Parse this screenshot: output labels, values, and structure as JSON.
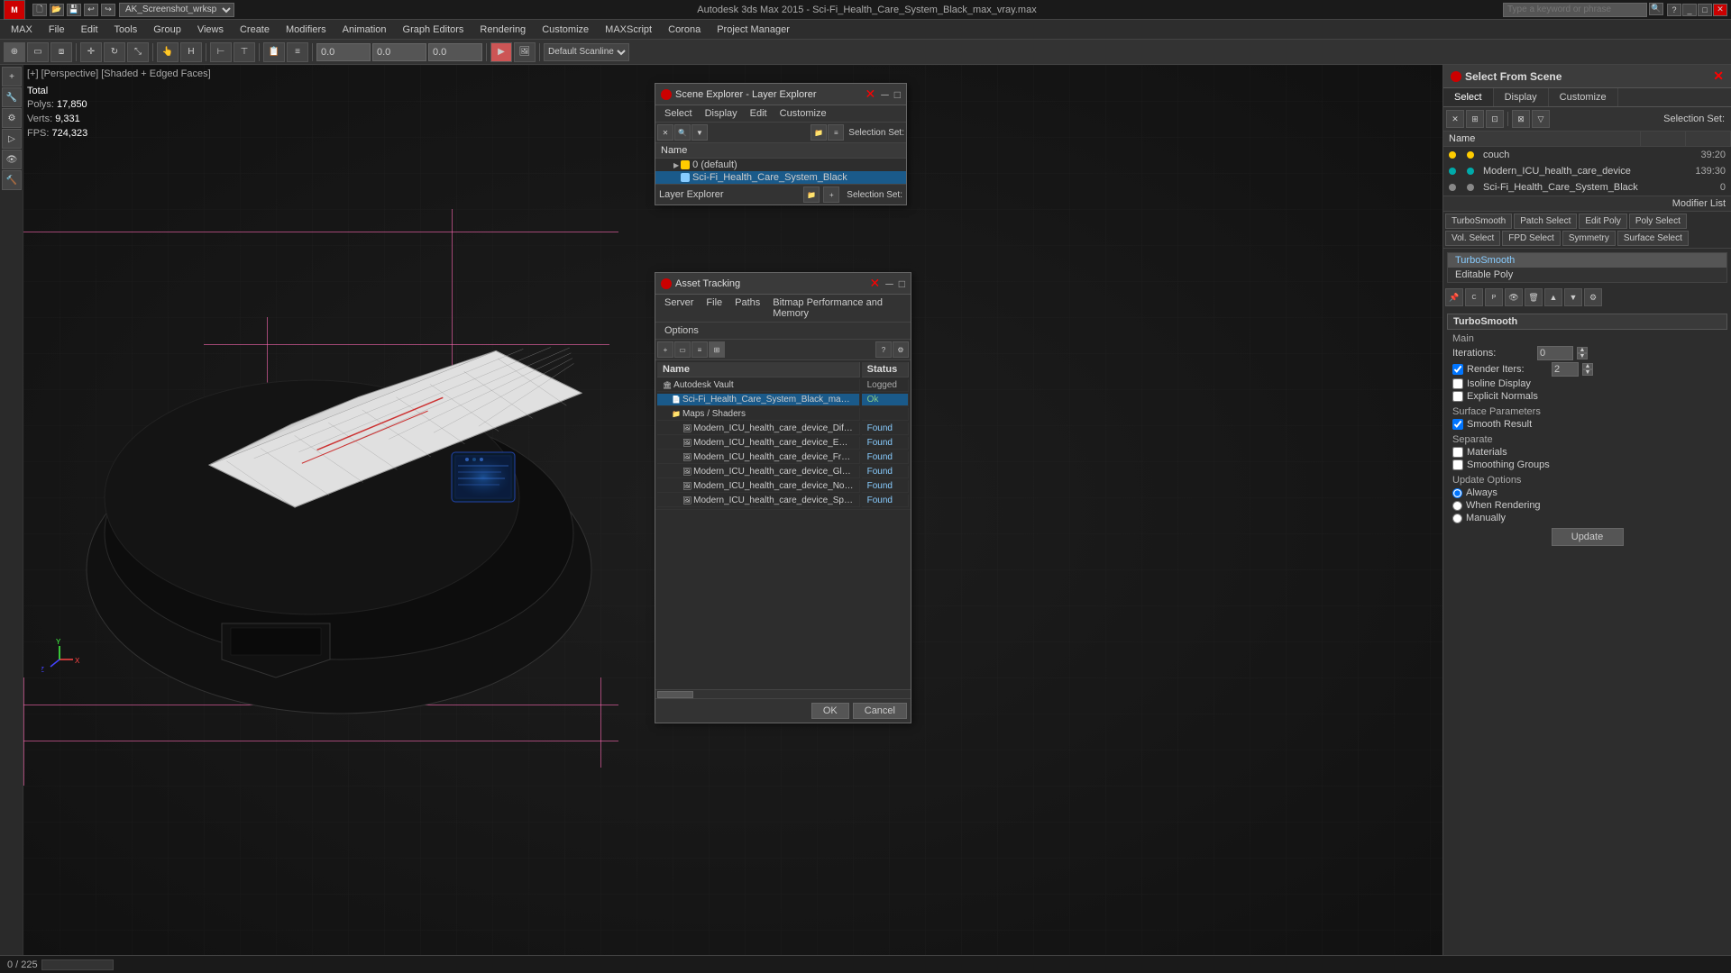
{
  "app": {
    "title": "Autodesk 3ds Max 2015 - Sci-Fi_Health_Care_System_Black_max_vray.max",
    "screenshot_name": "AK_Screenshot_wrksp"
  },
  "menubar": {
    "items": [
      "MAX",
      "File",
      "Edit",
      "Tools",
      "Group",
      "Views",
      "Create",
      "Modifiers",
      "Animation",
      "Graph Editors",
      "Rendering",
      "Customize",
      "MAXScript",
      "Corona",
      "Project Manager"
    ]
  },
  "viewport": {
    "label": "[+] [Perspective] [Shaded + Edged Faces]",
    "stats": {
      "total": "Total",
      "polys_label": "Polys:",
      "polys_value": "17,850",
      "verts_label": "Verts:",
      "verts_value": "9,331",
      "fps_label": "FPS:",
      "fps_value": "724,323"
    }
  },
  "scene_explorer": {
    "title": "Scene Explorer - Layer Explorer",
    "menus": [
      "Select",
      "Display",
      "Edit",
      "Customize"
    ],
    "columns": [
      "Name"
    ],
    "rows": [
      {
        "name": "0 (default)",
        "indent": 0,
        "type": "layer",
        "expanded": true
      },
      {
        "name": "Sci-Fi_Health_Care_System_Black",
        "indent": 1,
        "type": "layer",
        "selected": true
      }
    ],
    "footer": "Layer Explorer",
    "selection_set": "Selection Set:"
  },
  "select_from_scene": {
    "title": "Select From Scene",
    "tabs": [
      "Select",
      "Display",
      "Customize"
    ],
    "active_tab": "Select",
    "columns": [
      "Name",
      "",
      ""
    ],
    "objects": [
      {
        "name": "couch",
        "count": "39:20",
        "dot_color": "yellow"
      },
      {
        "name": "Modern_ICU_health_care_device",
        "count": "139:30",
        "dot_color": "teal"
      },
      {
        "name": "Sci-Fi_Health_Care_System_Black",
        "count": "0",
        "dot_color": "gray"
      }
    ],
    "selection_set_label": "Selection Set:"
  },
  "asset_tracking": {
    "title": "Asset Tracking",
    "menus": [
      "Server",
      "File",
      "Paths",
      "Bitmap Performance and Memory",
      "Options"
    ],
    "columns": [
      "Name",
      "Status"
    ],
    "assets": [
      {
        "name": "Autodesk Vault",
        "status": "",
        "indent": 0,
        "type": "folder"
      },
      {
        "name": "Sci-Fi_Health_Care_System_Black_max_vray.max",
        "status": "Ok",
        "indent": 1,
        "type": "file"
      },
      {
        "name": "Maps / Shaders",
        "status": "",
        "indent": 1,
        "type": "folder"
      },
      {
        "name": "Modern_ICU_health_care_device_Diffuse...",
        "status": "Found",
        "indent": 2,
        "type": "map"
      },
      {
        "name": "Modern_ICU_health_care_device_Emissive...",
        "status": "Found",
        "indent": 2,
        "type": "map"
      },
      {
        "name": "Modern_ICU_health_care_device_Fresnel...",
        "status": "Found",
        "indent": 2,
        "type": "map"
      },
      {
        "name": "Modern_ICU_health_care_device_Glossine...",
        "status": "Found",
        "indent": 2,
        "type": "map"
      },
      {
        "name": "Modern_ICU_health_care_device_Normal...",
        "status": "Found",
        "indent": 2,
        "type": "map"
      },
      {
        "name": "Modern_ICU_health_care_device_Specular...",
        "status": "Found",
        "indent": 2,
        "type": "map"
      }
    ]
  },
  "modifier_panel": {
    "header": "Modifier List",
    "buttons": {
      "turbosmooth": "TurboSmooth",
      "patch_select": "Patch Select",
      "edit_poly": "Edit Poly",
      "poly_select": "Poly Select",
      "vol_select": "Vol. Select",
      "fpd_select": "FPD Select",
      "symmetry": "Symmetry",
      "surface_select": "Surface Select"
    },
    "stack": [
      {
        "name": "TurboSmooth",
        "active": true
      },
      {
        "name": "Editable Poly",
        "active": false
      }
    ],
    "turbosmooth": {
      "section": "TurboSmooth",
      "main_label": "Main",
      "iterations_label": "Iterations:",
      "iterations_value": "0",
      "render_iters_label": "Render Iters:",
      "render_iters_value": "2",
      "isoline_display_label": "Isoline Display",
      "explicit_normals_label": "Explicit Normals",
      "surface_params_label": "Surface Parameters",
      "smooth_result_label": "Smooth Result",
      "smooth_result_checked": true,
      "separate_label": "Separate",
      "materials_label": "Materials",
      "smoothing_groups_label": "Smoothing Groups",
      "update_options_label": "Update Options",
      "always_label": "Always",
      "when_rendering_label": "When Rendering",
      "manually_label": "Manually",
      "update_btn": "Update"
    }
  },
  "statusbar": {
    "text": "0 / 225"
  },
  "search": {
    "placeholder": "Type a keyword or phrase"
  },
  "colors": {
    "bg_dark": "#1a1a1a",
    "bg_mid": "#2d2d2d",
    "bg_light": "#3c3c3c",
    "accent_blue": "#1a5a8a",
    "accent_selected": "#1a5a8a",
    "border": "#555",
    "text": "#ccc",
    "text_bright": "#fff",
    "pink_guide": "#ff69b4",
    "status_ok": "#88cc88",
    "status_found": "#88ccff"
  }
}
